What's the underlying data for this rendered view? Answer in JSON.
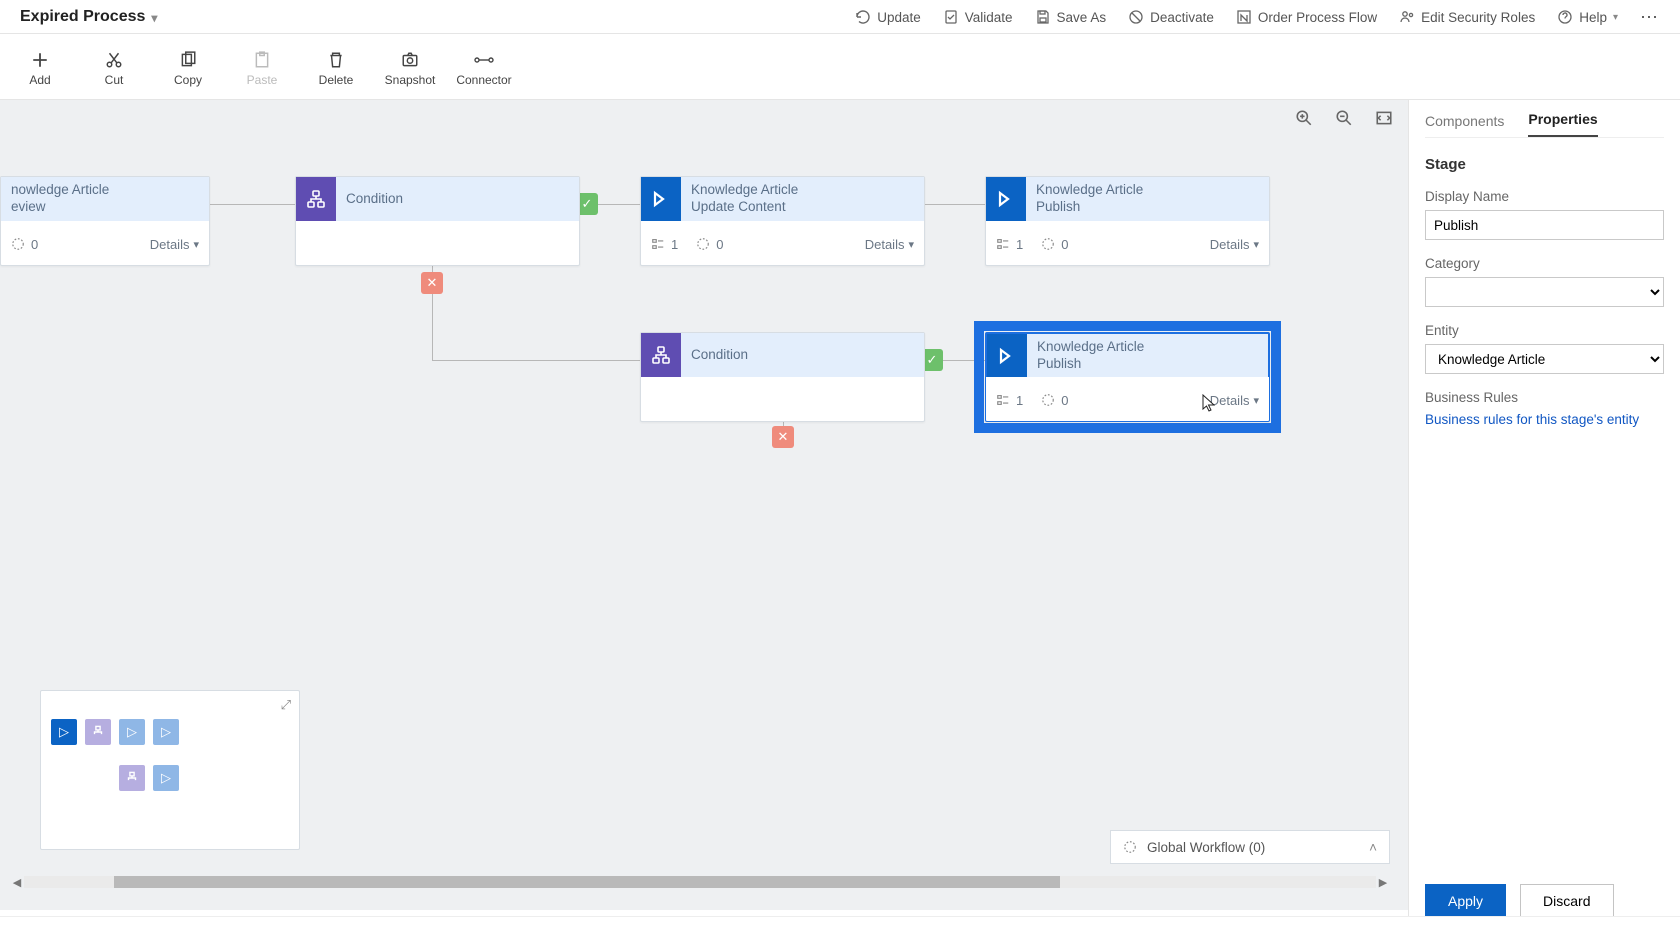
{
  "title": "Expired Process",
  "commands": {
    "update": "Update",
    "validate": "Validate",
    "save_as": "Save As",
    "deactivate": "Deactivate",
    "order": "Order Process Flow",
    "edit_roles": "Edit Security Roles",
    "help": "Help"
  },
  "ribbon": {
    "add": "Add",
    "cut": "Cut",
    "copy": "Copy",
    "paste": "Paste",
    "delete": "Delete",
    "snapshot": "Snapshot",
    "connector": "Connector"
  },
  "cards": {
    "review": {
      "line1": "nowledge Article",
      "line2": "eview",
      "steps": "0",
      "details": "Details"
    },
    "cond1": {
      "label": "Condition"
    },
    "update": {
      "line1": "Knowledge Article",
      "line2": "Update Content",
      "steps": "1",
      "trig": "0",
      "details": "Details"
    },
    "pub_top": {
      "line1": "Knowledge Article",
      "line2": "Publish",
      "steps": "1",
      "trig": "0",
      "details": "Details"
    },
    "cond2": {
      "label": "Condition"
    },
    "pub_sel": {
      "line1": "Knowledge Article",
      "line2": "Publish",
      "steps": "1",
      "trig": "0",
      "details": "Details"
    }
  },
  "global_workflow": "Global Workflow (0)",
  "side": {
    "tab_components": "Components",
    "tab_properties": "Properties",
    "section": "Stage",
    "display_name_label": "Display Name",
    "display_name_value": "Publish",
    "category_label": "Category",
    "category_value": "",
    "entity_label": "Entity",
    "entity_value": "Knowledge Article",
    "br_label": "Business Rules",
    "br_link": "Business rules for this stage's entity",
    "apply": "Apply",
    "discard": "Discard"
  },
  "status_text": ""
}
